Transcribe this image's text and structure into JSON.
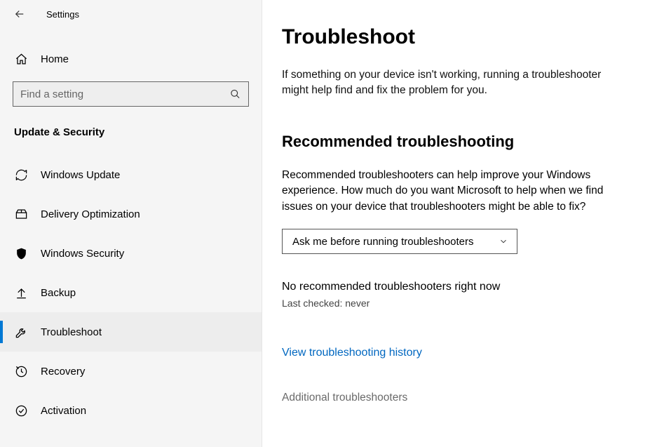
{
  "header": {
    "app_title": "Settings"
  },
  "sidebar": {
    "home_label": "Home",
    "search_placeholder": "Find a setting",
    "section_title": "Update & Security",
    "items": [
      {
        "label": "Windows Update"
      },
      {
        "label": "Delivery Optimization"
      },
      {
        "label": "Windows Security"
      },
      {
        "label": "Backup"
      },
      {
        "label": "Troubleshoot"
      },
      {
        "label": "Recovery"
      },
      {
        "label": "Activation"
      }
    ]
  },
  "main": {
    "title": "Troubleshoot",
    "intro": "If something on your device isn't working, running a troubleshooter might help find and fix the problem for you.",
    "recommended_heading": "Recommended troubleshooting",
    "recommended_text": "Recommended troubleshooters can help improve your Windows experience. How much do you want Microsoft to help when we find issues on your device that troubleshooters might be able to fix?",
    "dropdown_value": "Ask me before running troubleshooters",
    "no_recommendations": "No recommended troubleshooters right now",
    "last_checked": "Last checked: never",
    "history_link": "View troubleshooting history",
    "additional_link": "Additional troubleshooters"
  }
}
